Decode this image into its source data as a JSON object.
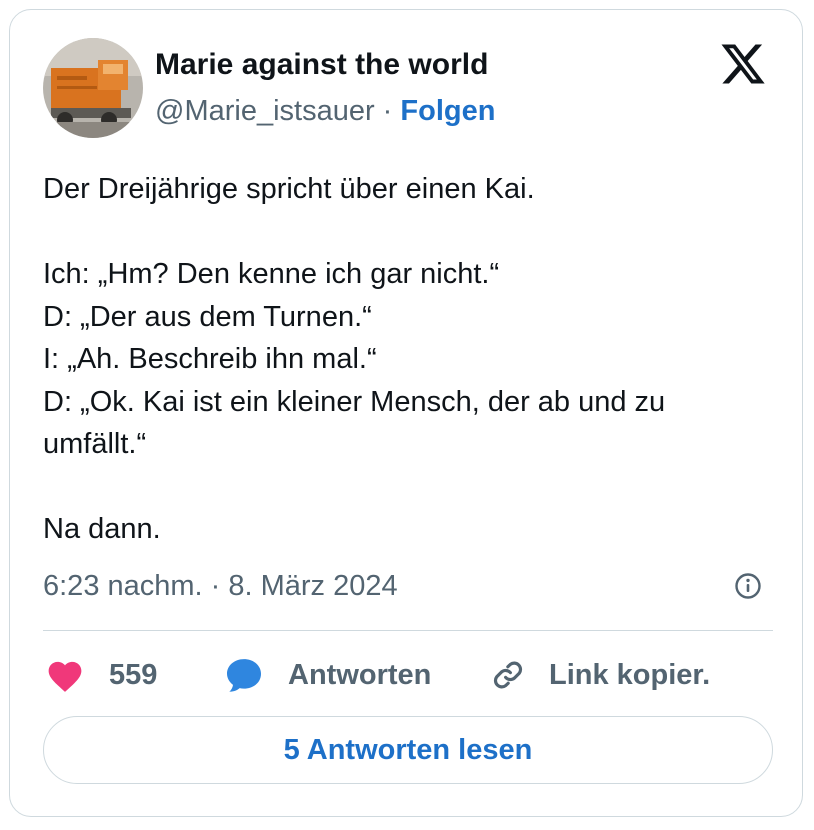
{
  "tweet": {
    "author_name": "Marie against the world",
    "handle": "@Marie_istsauer",
    "separator": " · ",
    "follow_label": "Folgen",
    "lines": [
      "Der Dreijährige spricht über einen Kai.",
      "",
      "Ich: „Hm? Den kenne ich gar nicht.“",
      "D: „Der aus dem Turnen.“",
      "I: „Ah. Beschreib ihn mal.“",
      "D: „Ok. Kai ist ein kleiner Mensch, der ab und zu",
      "umfällt.“",
      "",
      "Na dann."
    ],
    "timestamp": "6:23 nachm. · 8. März 2024"
  },
  "actions": {
    "like_count": "559",
    "reply_label": "Antworten",
    "copy_label": "Link kopier."
  },
  "read_replies_label": "5 Antworten lesen",
  "icons": {
    "platform": "x-logo-icon",
    "info": "info-icon",
    "like": "heart-icon",
    "reply": "speech-bubble-icon",
    "copy": "link-icon"
  },
  "colors": {
    "accent": "#1d70c8",
    "like": "#f0387a",
    "reply": "#2f86df",
    "secondary_text": "#536471",
    "border": "#cfd9de"
  }
}
